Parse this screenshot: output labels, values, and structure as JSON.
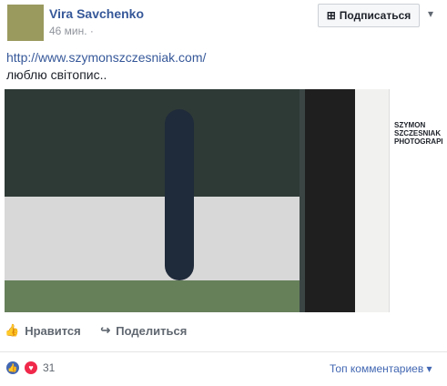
{
  "author": {
    "name": "Vira Savchenko",
    "time": "46 мин. ·"
  },
  "subscribe": "Подписаться",
  "link": "http://www.szymonszczesniak.com/",
  "text": "люблю світопис..",
  "photo": {
    "book_title": "SZYMON SZCZESNIAK PHOTOGRAPHY"
  },
  "actions": {
    "like": "Нравится",
    "share": "Поделиться"
  },
  "reactions": {
    "count": "31"
  },
  "comments": {
    "sort": "Топ комментариев ▾"
  },
  "colors": {
    "link": "#365899"
  }
}
